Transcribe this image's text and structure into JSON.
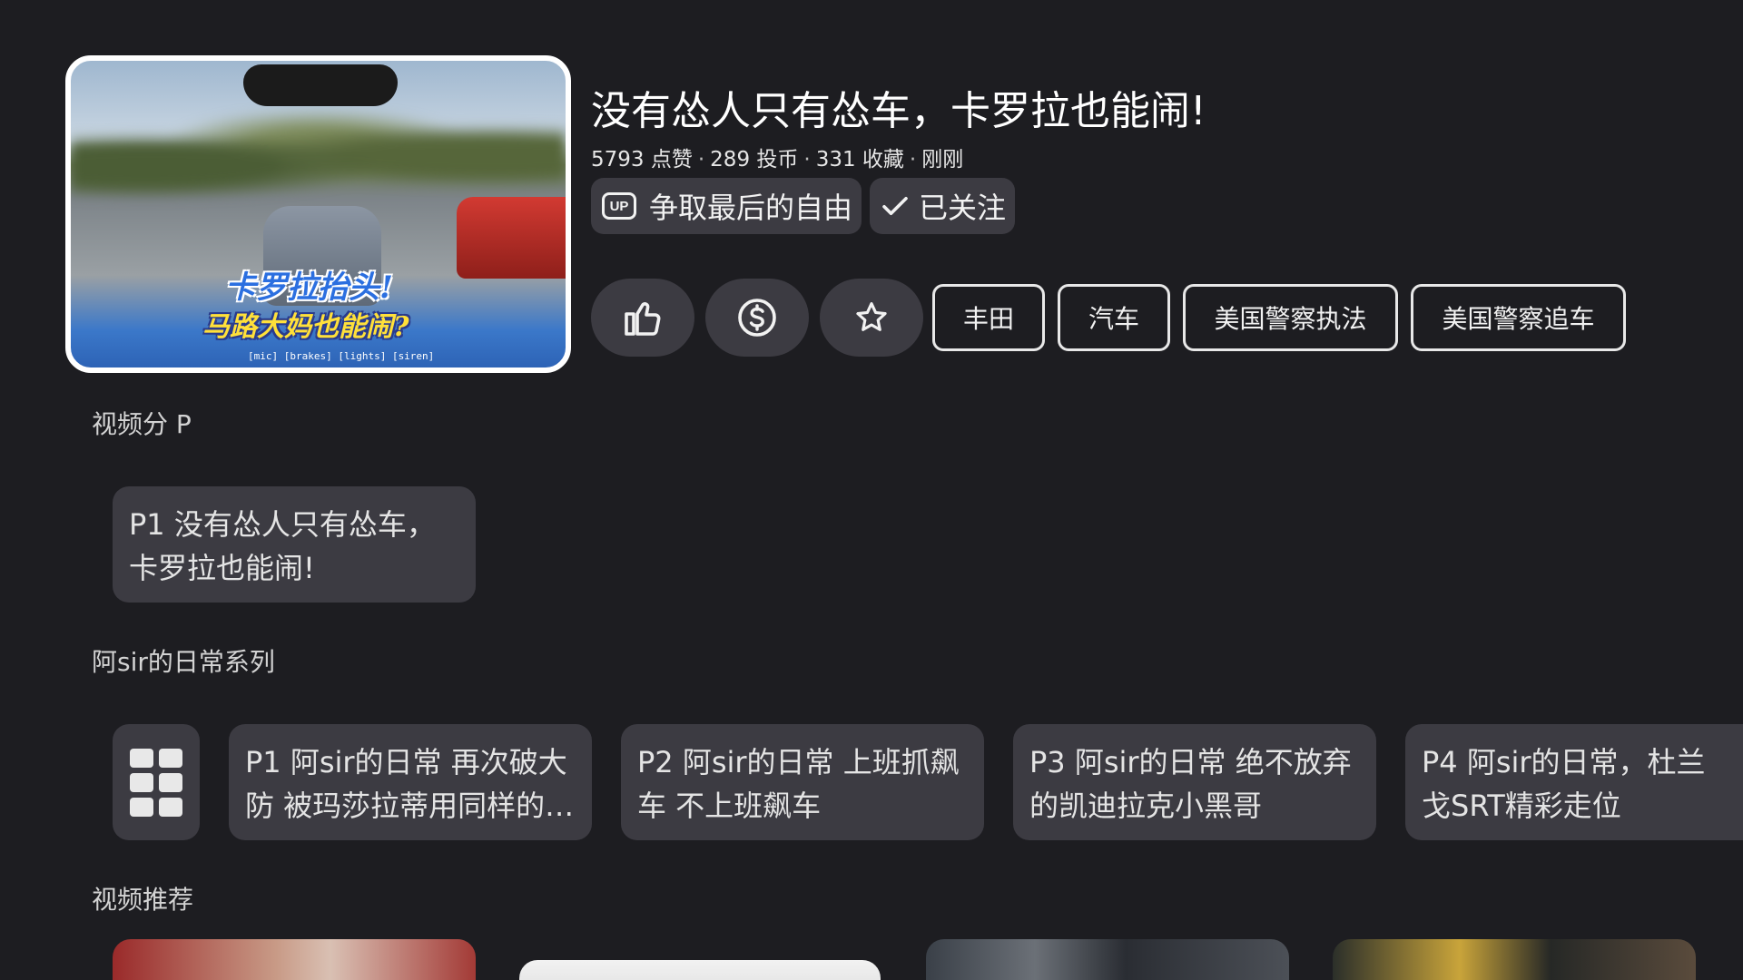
{
  "video": {
    "title": "没有怂人只有怂车，卡罗拉也能闹!",
    "likes": "5793 点赞",
    "coins": "289 投币",
    "favorites": "331 收藏",
    "time": "刚刚",
    "stat_separator": "·",
    "thumbnail_caption_line1": "卡罗拉抬头!",
    "thumbnail_caption_line2": "马路大妈也能闹?",
    "thumbnail_subtitle": "[mic] [brakes] [lights] [siren]"
  },
  "uploader": {
    "badge": "UP",
    "name": "争取最后的自由",
    "follow_label": "已关注"
  },
  "actions": {
    "like_icon": "thumbs-up-icon",
    "coin_icon": "coin-icon",
    "favorite_icon": "star-icon"
  },
  "tags": [
    "丰田",
    "汽车",
    "美国警察执法",
    "美国警察追车"
  ],
  "parts_section": {
    "title": "视频分 P",
    "items": [
      "P1 没有怂人只有怂车，卡罗拉也能闹!"
    ]
  },
  "series_section": {
    "title": "阿sir的日常系列",
    "grid_icon": "grid-icon",
    "items": [
      "P1 阿sir的日常 再次破大防 被玛莎拉蒂用同样的…",
      "P2 阿sir的日常 上班抓飙车 不上班飙车",
      "P3 阿sir的日常 绝不放弃的凯迪拉克小黑哥",
      "P4 阿sir的日常，杜兰戈SRT精彩走位"
    ]
  },
  "recommend_section": {
    "title": "视频推荐"
  },
  "colors": {
    "background": "#1d1d21",
    "card": "#3c3b42",
    "text": "#f0f0f0"
  }
}
